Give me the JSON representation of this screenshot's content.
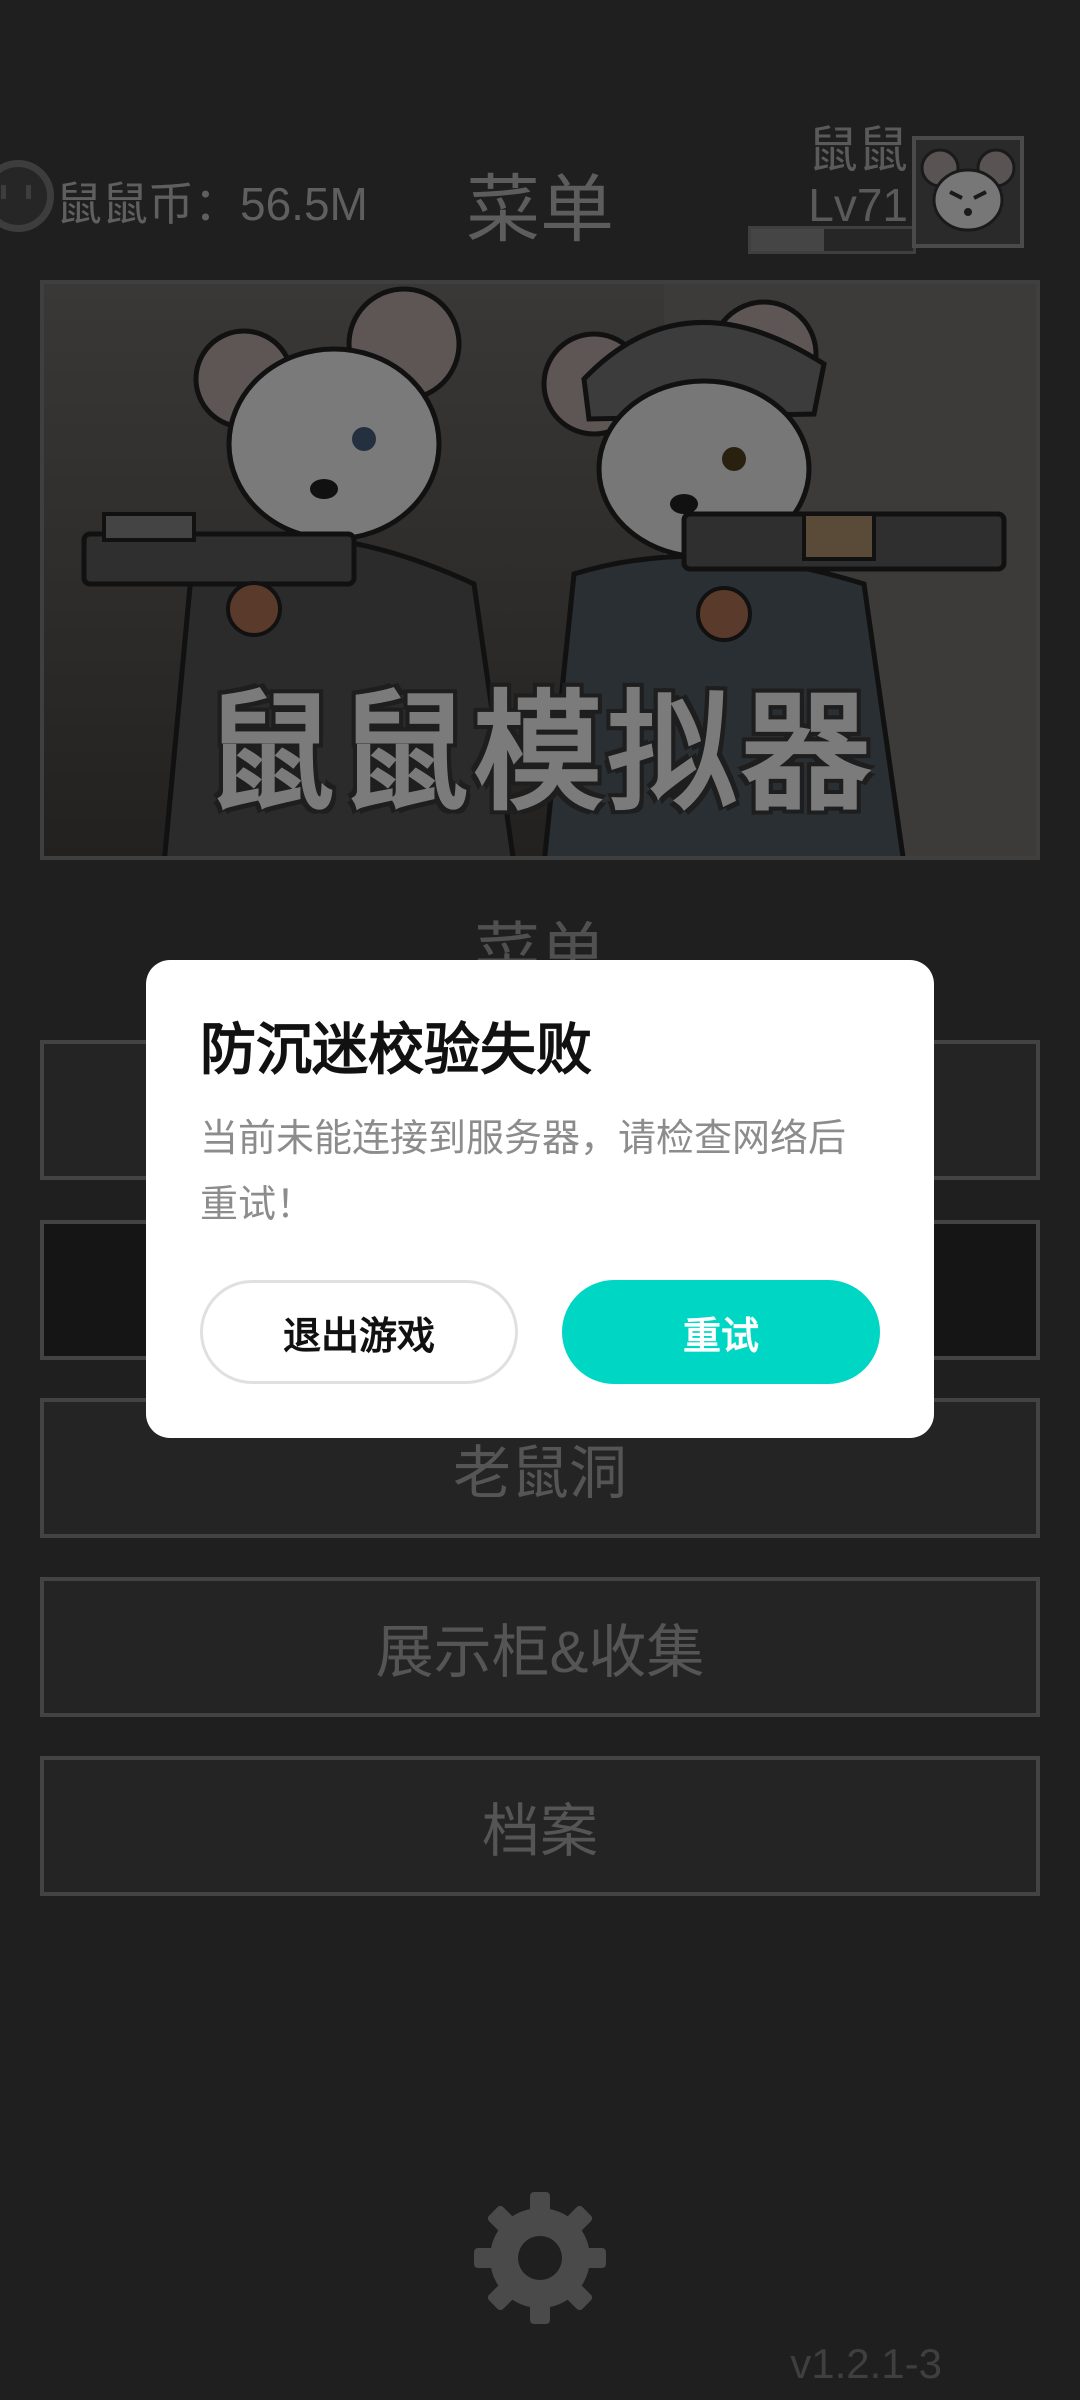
{
  "header": {
    "currency": "鼠鼠币：56.5M",
    "title": "菜单",
    "player_name": "鼠鼠",
    "level": "Lv71",
    "xp_progress": 0.45
  },
  "banner": {
    "title": "鼠鼠模拟器"
  },
  "menu": {
    "section_title": "菜单",
    "items": [
      {
        "label": ""
      },
      {
        "label": ""
      },
      {
        "label": "老鼠洞"
      },
      {
        "label": "展示柜&收集"
      },
      {
        "label": "档案"
      }
    ]
  },
  "footer": {
    "settings_icon": "gear-icon",
    "version": "v1.2.1-3"
  },
  "dialog": {
    "title": "防沉迷校验失败",
    "message": "当前未能连接到服务器，请检查网络后重试！",
    "exit_label": "退出游戏",
    "retry_label": "重试",
    "accent": "#00d6c4"
  }
}
